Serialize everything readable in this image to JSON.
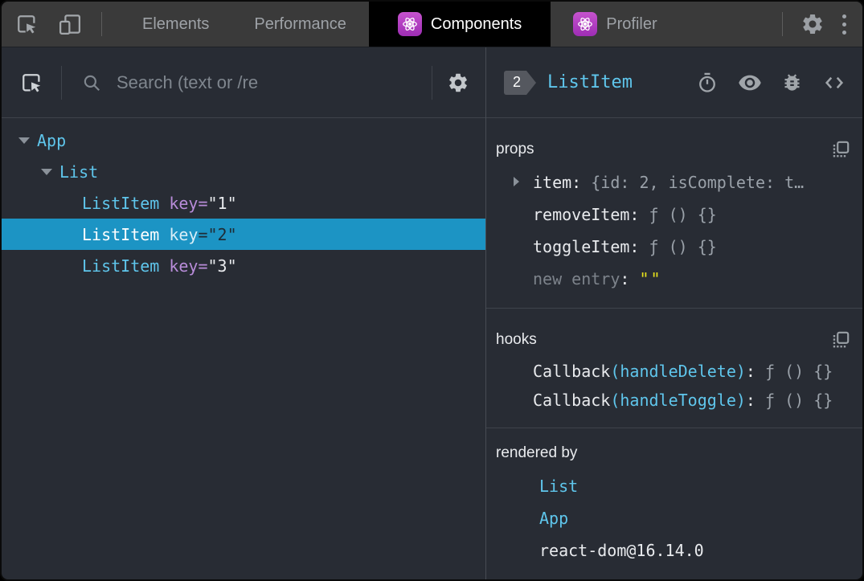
{
  "chrome": {
    "tabs": [
      {
        "label": "Elements",
        "selected": false
      },
      {
        "label": "Performance",
        "selected": false
      },
      {
        "label": "Components",
        "selected": true
      },
      {
        "label": "Profiler",
        "selected": false
      }
    ],
    "icons": [
      "inspect-element",
      "toggle-device-toolbar",
      "react-logo",
      "settings-gear",
      "more-options-kebab"
    ]
  },
  "left_panel": {
    "icons": [
      "pick-component",
      "search-magnifier",
      "view-settings-gear"
    ],
    "search_placeholder": "Search (text or /re",
    "tree": [
      {
        "label": "App",
        "depth": 0,
        "expanded": true,
        "selected": false
      },
      {
        "label": "List",
        "depth": 1,
        "expanded": true,
        "selected": false
      },
      {
        "label": "ListItem",
        "attr": "key",
        "eq": "=",
        "value": "\"1\"",
        "depth": 2,
        "selected": false
      },
      {
        "label": "ListItem",
        "attr": "key",
        "eq": "=",
        "value": "\"2\"",
        "depth": 2,
        "selected": true
      },
      {
        "label": "ListItem",
        "attr": "key",
        "eq": "=",
        "value": "\"3\"",
        "depth": 2,
        "selected": false
      }
    ]
  },
  "right_panel": {
    "owner_badge": "2",
    "component_title": "ListItem",
    "toolbar_icons": [
      "suspense-stopwatch",
      "inspect-dom-eye",
      "log-to-console-bug",
      "view-source-brackets"
    ],
    "props": {
      "header": "props",
      "rows": [
        {
          "name": "item",
          "colon": ":",
          "value": "{id: 2, isComplete: t…",
          "expandable": true
        },
        {
          "name": "removeItem",
          "colon": ":",
          "value": "ƒ () {}",
          "expandable": false
        },
        {
          "name": "toggleItem",
          "colon": ":",
          "value": "ƒ () {}",
          "expandable": false
        }
      ],
      "new_entry": {
        "name": "new entry",
        "colon": ":",
        "value": "\"\""
      }
    },
    "hooks": {
      "header": "hooks",
      "rows": [
        {
          "kind": "Callback",
          "open": "(",
          "hook": "handleDelete",
          "close": ")",
          "colon": ":",
          "value": "ƒ () {}"
        },
        {
          "kind": "Callback",
          "open": "(",
          "hook": "handleToggle",
          "close": ")",
          "colon": ":",
          "value": "ƒ () {}"
        }
      ]
    },
    "rendered_by": {
      "header": "rendered by",
      "items": [
        {
          "label": "List",
          "link": true
        },
        {
          "label": "App",
          "link": true
        },
        {
          "label": "react-dom@16.14.0",
          "link": false
        }
      ]
    }
  },
  "colors": {
    "panel_bg": "#282c34",
    "chrome_bg": "#3a3a3a",
    "selection_bg": "#1c94c4",
    "component_cyan": "#5fc6ec",
    "attr_purple": "#b88cd9",
    "string_yellow": "#e6e11c",
    "react_icon_purple": "#a83bbb"
  }
}
